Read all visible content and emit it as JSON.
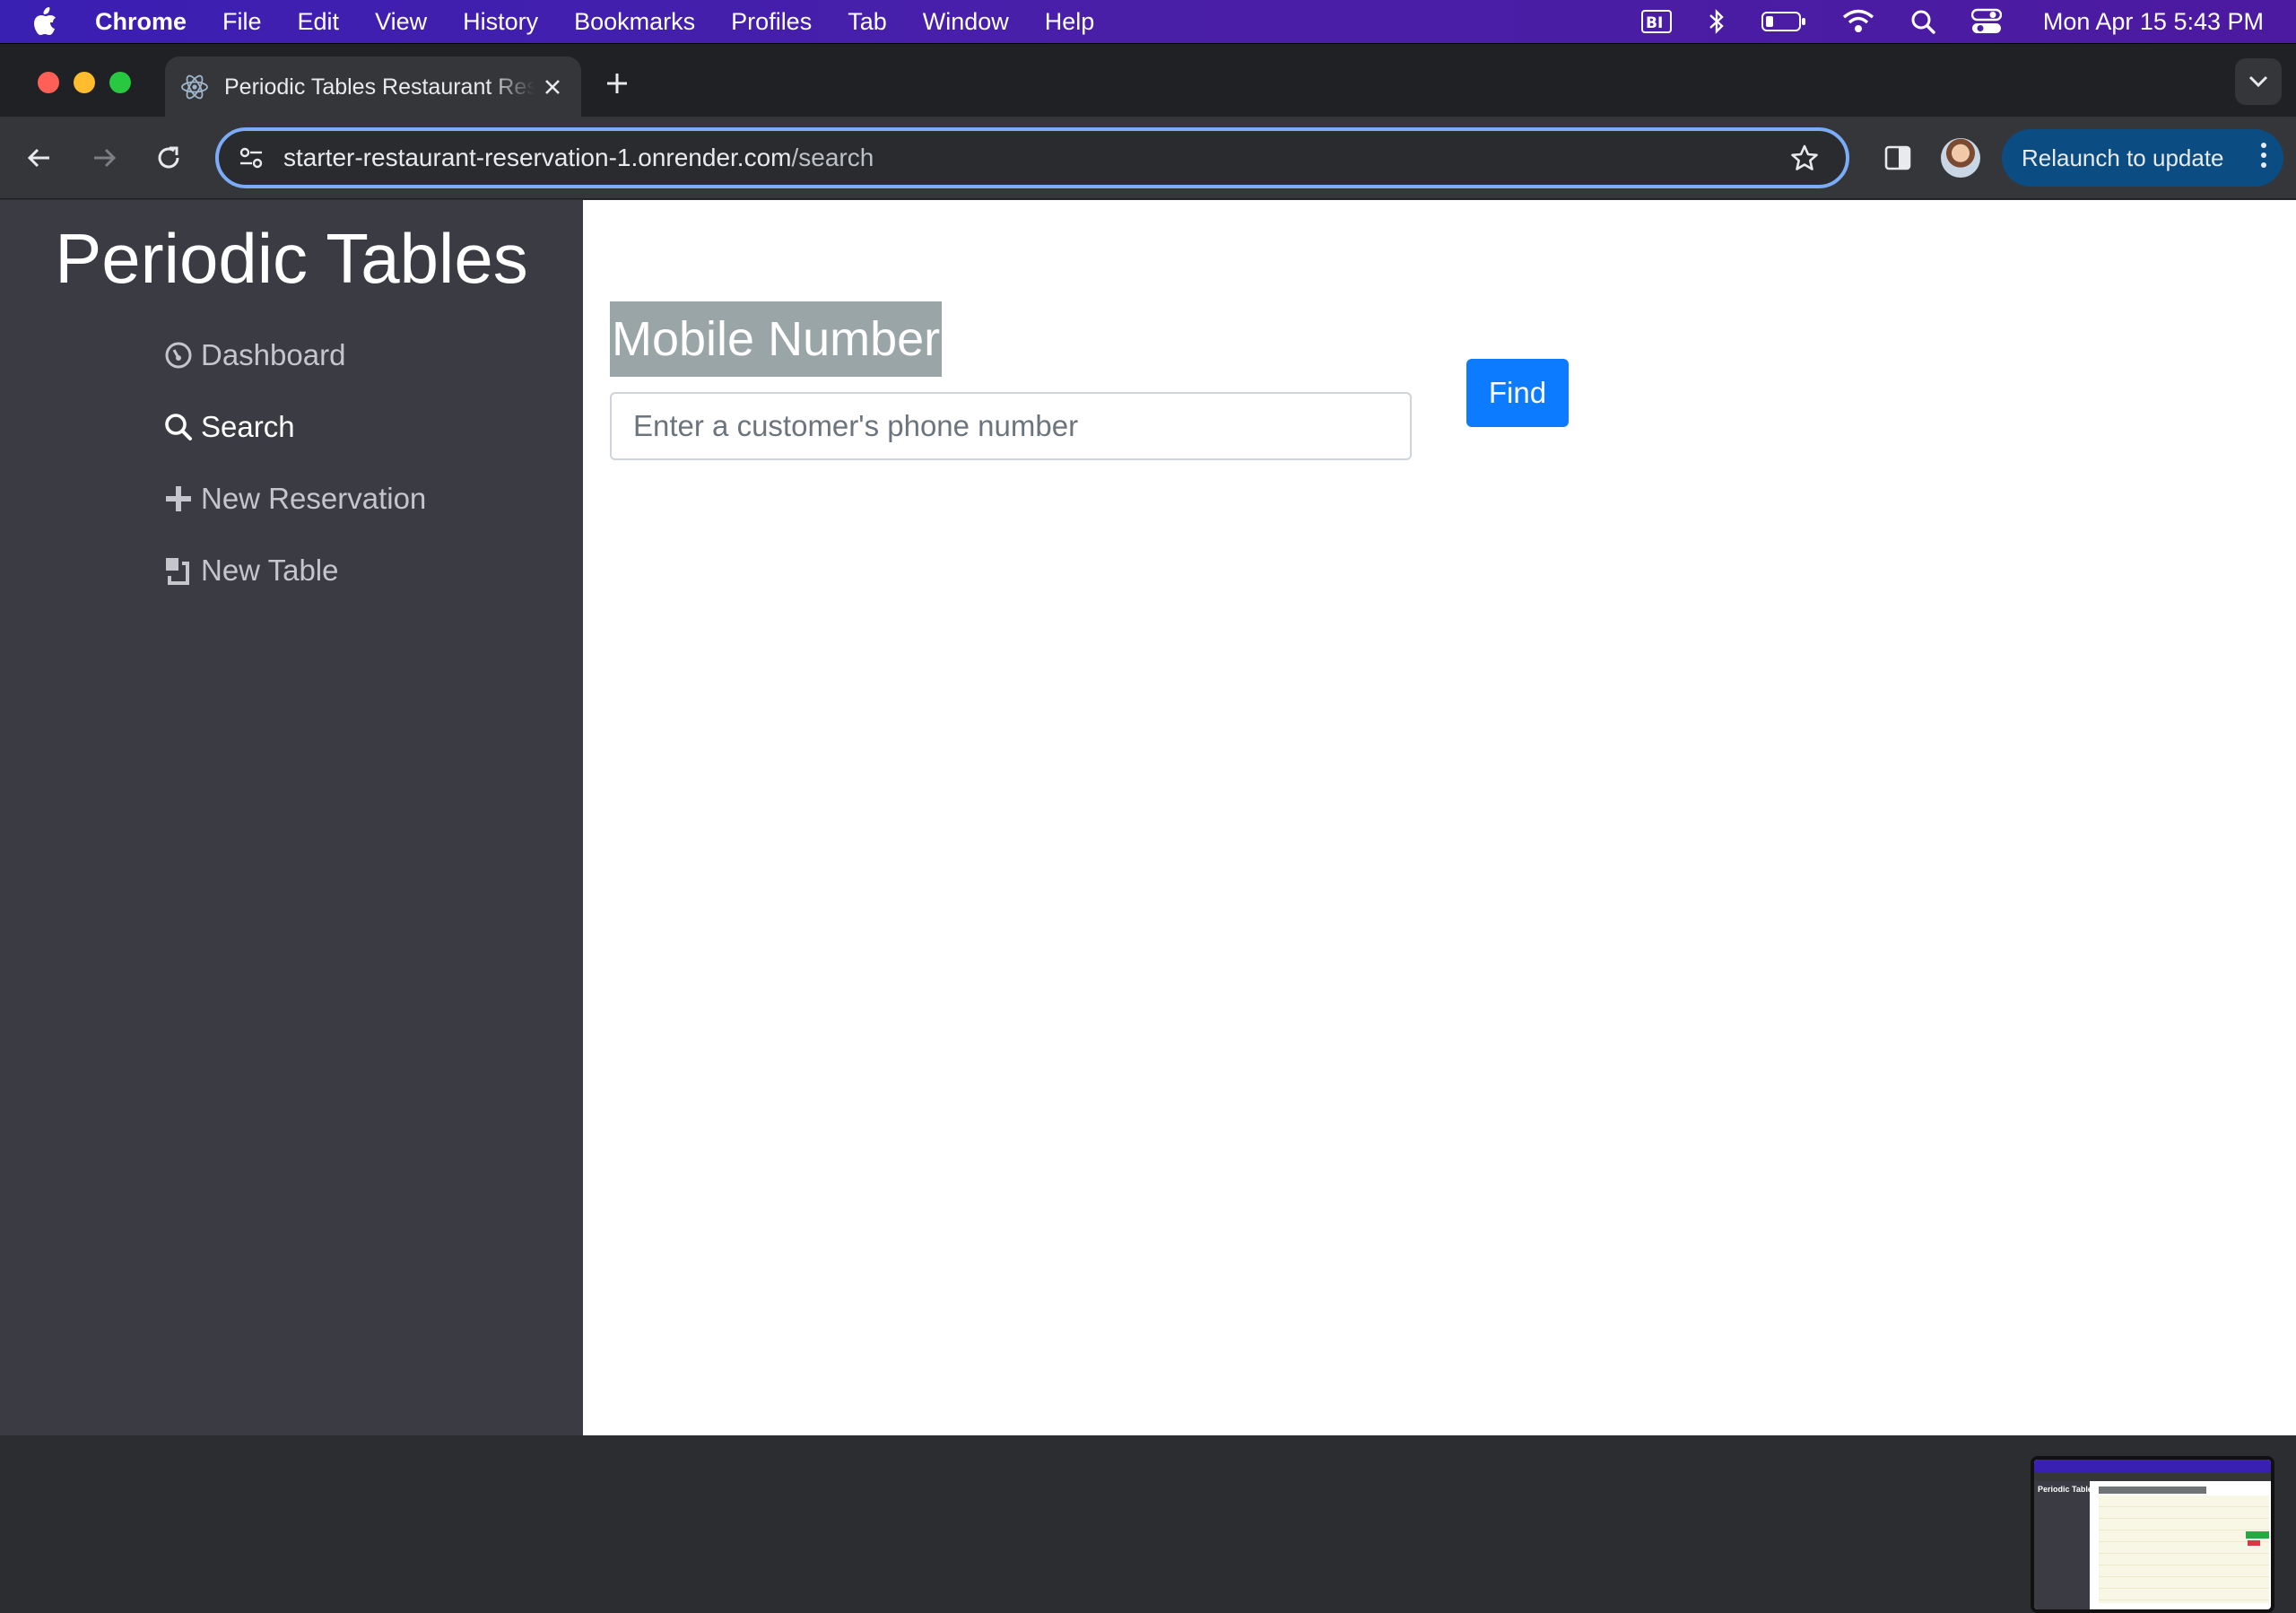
{
  "menubar": {
    "app": "Chrome",
    "items": [
      "File",
      "Edit",
      "View",
      "History",
      "Bookmarks",
      "Profiles",
      "Tab",
      "Window",
      "Help"
    ],
    "clock": "Mon Apr 15  5:43 PM",
    "status_icons": [
      "bi-icon",
      "bluetooth-icon",
      "battery-icon",
      "wifi-icon",
      "spotlight-icon",
      "control-center-icon"
    ]
  },
  "browser": {
    "tab_title": "Periodic Tables Restaurant Reservation",
    "url_host": "starter-restaurant-reservation-1.onrender.com",
    "url_path": "/search",
    "relaunch_label": "Relaunch to update"
  },
  "sidebar": {
    "brand": "Periodic Tables",
    "items": [
      {
        "label": "Dashboard",
        "icon": "dashboard-icon"
      },
      {
        "label": "Search",
        "icon": "search-icon"
      },
      {
        "label": "New Reservation",
        "icon": "plus-icon"
      },
      {
        "label": "New Table",
        "icon": "table-icon"
      }
    ]
  },
  "search": {
    "label": "Mobile Number",
    "placeholder": "Enter a customer's phone number",
    "value": "",
    "button": "Find"
  },
  "thumbnail": {
    "brand": "Periodic Tables"
  }
}
